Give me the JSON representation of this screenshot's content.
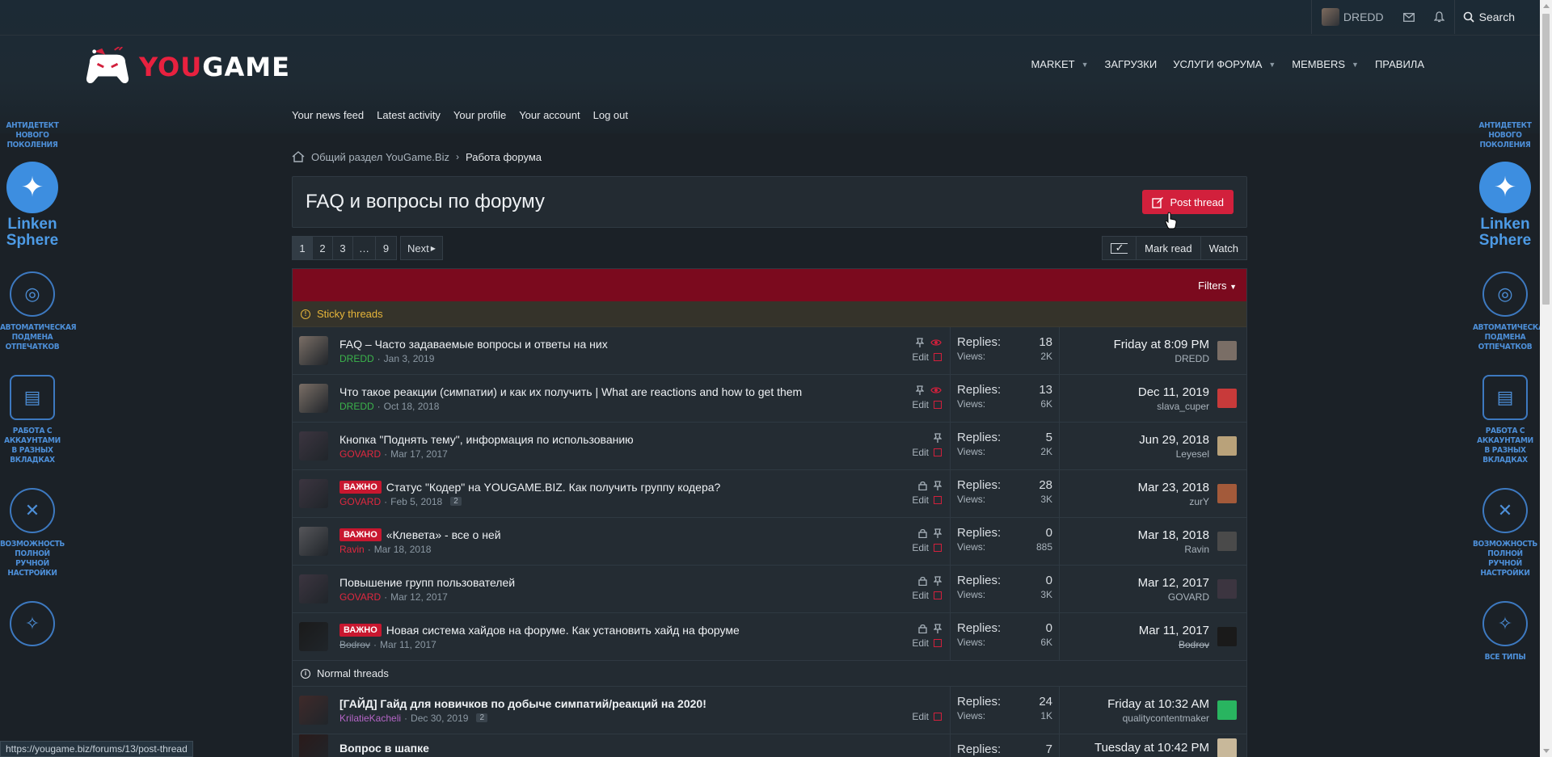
{
  "header": {
    "username": "DREDD",
    "search_label": "Search",
    "logo_text_you": "YOU",
    "logo_text_game": "GAME",
    "nav": [
      {
        "label": "MARKET",
        "dropdown": true
      },
      {
        "label": "ЗАГРУЗКИ",
        "dropdown": false
      },
      {
        "label": "УСЛУГИ ФОРУМА",
        "dropdown": true
      },
      {
        "label": "MEMBERS",
        "dropdown": true
      },
      {
        "label": "ПРАВИЛА",
        "dropdown": false
      }
    ],
    "subnav": [
      "Your news feed",
      "Latest activity",
      "Your profile",
      "Your account",
      "Log out"
    ]
  },
  "side_banner": {
    "block1": "АНТИДЕТЕКТ НОВОГО ПОКОЛЕНИЯ",
    "brand": "Linken Sphere",
    "block2": "АВТОМАТИЧЕСКАЯ ПОДМЕНА ОТПЕЧАТКОВ",
    "block3": "РАБОТА С АККАУНТАМИ В РАЗНЫХ ВКЛАДКАХ",
    "block4": "ВОЗМОЖНОСТЬ ПОЛНОЙ РУЧНОЙ НАСТРОЙКИ",
    "block5": "ВСЕ ТИПЫ"
  },
  "breadcrumb": [
    "Общий раздел YouGame.Biz",
    "Работа форума"
  ],
  "page": {
    "title": "FAQ и вопросы по форуму",
    "post_thread": "Post thread",
    "pages": [
      "1",
      "2",
      "3",
      "…",
      "9"
    ],
    "next": "Next",
    "mark_read": "Mark read",
    "watch": "Watch",
    "filters": "Filters"
  },
  "sections": {
    "sticky": "Sticky threads",
    "normal": "Normal threads"
  },
  "labels": {
    "replies": "Replies:",
    "views": "Views:",
    "edit": "Edit",
    "badge": "ВАЖНО"
  },
  "threads": [
    {
      "title": "FAQ – Часто задаваемые вопросы и ответы на них",
      "author": "DREDD",
      "author_style": "green",
      "date": "Jan 3, 2019",
      "pages": "",
      "badge": false,
      "replies": "18",
      "views": "2K",
      "last_date": "Friday at 8:09 PM",
      "last_user": "DREDD",
      "last_style": "green",
      "icons": [
        "pin-icon",
        "eye-icon"
      ]
    },
    {
      "title": "Что такое реакции (симпатии) и как их получить | What are reactions and how to get them",
      "author": "DREDD",
      "author_style": "green",
      "date": "Oct 18, 2018",
      "pages": "",
      "badge": false,
      "replies": "13",
      "views": "6K",
      "last_date": "Dec 11, 2019",
      "last_user": "slava_cuper",
      "last_style": "plain",
      "icons": [
        "pin-icon",
        "eye-icon"
      ]
    },
    {
      "title": "Кнопка \"Поднять тему\", информация по использованию",
      "author": "GOVARD",
      "author_style": "red",
      "date": "Mar 17, 2017",
      "pages": "",
      "badge": false,
      "replies": "5",
      "views": "2K",
      "last_date": "Jun 29, 2018",
      "last_user": "Leyesel",
      "last_style": "plain",
      "icons": [
        "pin-icon"
      ]
    },
    {
      "title": "Статус \"Кодер\" на YOUGAME.BIZ. Как получить группу кодера?",
      "author": "GOVARD",
      "author_style": "red",
      "date": "Feb 5, 2018",
      "pages": "2",
      "badge": true,
      "replies": "28",
      "views": "3K",
      "last_date": "Mar 23, 2018",
      "last_user": "zurY",
      "last_style": "plain",
      "icons": [
        "lock-icon",
        "pin-icon"
      ]
    },
    {
      "title": "«Клевета» - все о ней",
      "author": "Ravin",
      "author_style": "red",
      "date": "Mar 18, 2018",
      "pages": "",
      "badge": true,
      "replies": "0",
      "views": "885",
      "last_date": "Mar 18, 2018",
      "last_user": "Ravin",
      "last_style": "red",
      "icons": [
        "lock-icon",
        "pin-icon"
      ]
    },
    {
      "title": "Повышение групп пользователей",
      "author": "GOVARD",
      "author_style": "red",
      "date": "Mar 12, 2017",
      "pages": "",
      "badge": false,
      "replies": "0",
      "views": "3K",
      "last_date": "Mar 12, 2017",
      "last_user": "GOVARD",
      "last_style": "red",
      "icons": [
        "lock-icon",
        "pin-icon"
      ]
    },
    {
      "title": "Новая система хайдов на форуме. Как установить хайд на форуме",
      "author": "Bodrov",
      "author_style": "strike",
      "date": "Mar 11, 2017",
      "pages": "",
      "badge": true,
      "replies": "0",
      "views": "6K",
      "last_date": "Mar 11, 2017",
      "last_user": "Bodrov",
      "last_style": "strike",
      "icons": [
        "lock-icon",
        "pin-icon"
      ]
    }
  ],
  "normal_threads": [
    {
      "title": "[ГАЙД] Гайд для новичков по добыче симпатий/реакций на 2020!",
      "author": "KrilatieKacheli",
      "author_style": "purple",
      "date": "Dec 30, 2019",
      "pages": "2",
      "replies": "24",
      "views": "1K",
      "last_date": "Friday at 10:32 AM",
      "last_user": "qualitycontentmaker",
      "last_style": "plain"
    },
    {
      "title": "Вопрос в шапке",
      "replies": "7",
      "last_date": "Tuesday at 10:42 PM"
    }
  ],
  "status_url": "https://yougame.biz/forums/13/post-thread",
  "colors": {
    "accent": "#d2203c",
    "filter_bar": "#7b0a1e",
    "sticky": "#e6b53a",
    "side_blue": "#4d8fd8"
  }
}
